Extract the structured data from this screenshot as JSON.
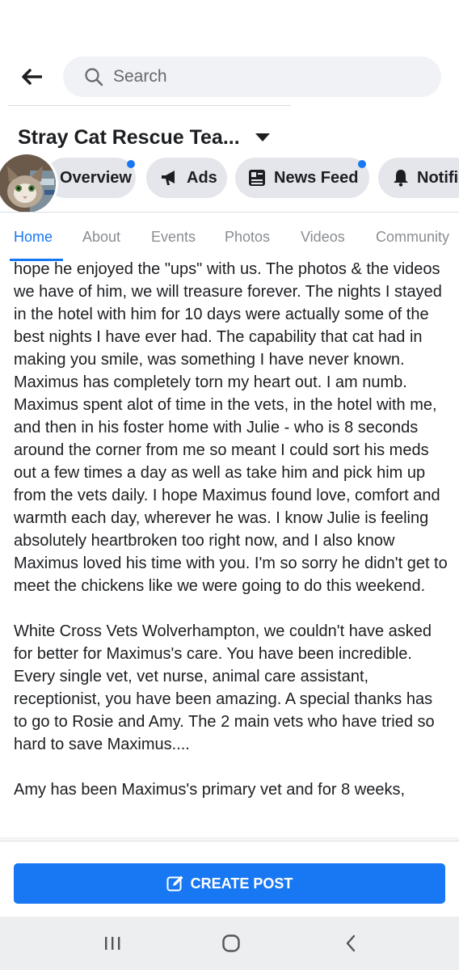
{
  "header": {
    "search_placeholder": "Search"
  },
  "page": {
    "title": "Stray Cat Rescue Tea..."
  },
  "chips": [
    {
      "label": "Overview",
      "icon": "overview",
      "dot": true
    },
    {
      "label": "Ads",
      "icon": "megaphone-icon",
      "dot": false
    },
    {
      "label": "News Feed",
      "icon": "news-feed-icon",
      "dot": true
    },
    {
      "label": "Notific",
      "icon": "bell-icon",
      "dot": false
    }
  ],
  "tabs": [
    "Home",
    "About",
    "Events",
    "Photos",
    "Videos",
    "Community"
  ],
  "post": {
    "paragraph1": "hope he enjoyed the \"ups\" with us. The photos & the videos we have of him, we will treasure forever. The nights I stayed in the hotel with him for 10 days were actually some of the best nights I have ever had. The capability that cat had in making you smile, was something I have never known. Maximus has completely torn my heart out. I am numb. Maximus spent alot of time in the vets, in the hotel with me, and then in his foster home with Julie  - who is 8 seconds around the corner from me so meant I could sort his meds out a few times a day as well as take him and pick him up from the vets daily. I hope Maximus found love, comfort and warmth each day, wherever he was. I know Julie is feeling absolutely heartbroken too right now, and I also know Maximus loved his time with you. I'm so sorry he didn't get to meet the chickens like we were going to do this weekend.",
    "paragraph2": "White Cross Vets Wolverhampton, we couldn't have asked for better for Maximus's care. You have been incredible. Every single vet, vet nurse, animal care assistant, receptionist, you have been amazing. A special thanks has to go to Rosie and Amy. The 2 main vets who have tried so hard to save Maximus....",
    "paragraph3": "Amy has been Maximus's primary vet and for 8 weeks,"
  },
  "actions": {
    "create_post": "CREATE POST"
  },
  "colors": {
    "accent": "#1877f2",
    "chip_bg": "#e4e6eb",
    "search_bg": "#f0f2f5"
  }
}
